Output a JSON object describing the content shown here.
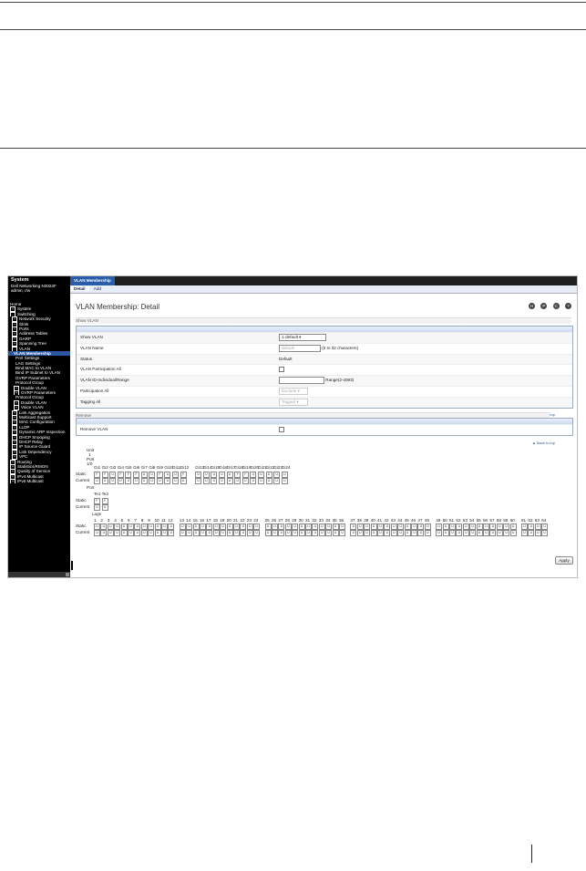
{
  "sidebar": {
    "title": "System",
    "device": "Dell Networking N3024F",
    "user": "admin, r/w",
    "items": [
      {
        "label": "Home",
        "pm": ""
      },
      {
        "label": "System",
        "pm": "+"
      },
      {
        "label": "Switching",
        "pm": "-"
      },
      {
        "label": "Network Security",
        "pm": "+"
      },
      {
        "label": "Slots",
        "pm": "+"
      },
      {
        "label": "Ports",
        "pm": "+"
      },
      {
        "label": "Address Tables",
        "pm": "+"
      },
      {
        "label": "GARP",
        "pm": "+"
      },
      {
        "label": "Spanning Tree",
        "pm": "+"
      },
      {
        "label": "VLAN",
        "pm": "-"
      },
      {
        "label": "VLAN Membership",
        "pm": ""
      },
      {
        "label": "Port Settings",
        "pm": ""
      },
      {
        "label": "LAG Settings",
        "pm": ""
      },
      {
        "label": "Bind MAC to VLAN",
        "pm": ""
      },
      {
        "label": "Bind IP Subnet to VLAN",
        "pm": ""
      },
      {
        "label": "GVRP Parameters",
        "pm": ""
      },
      {
        "label": "Protocol Group",
        "pm": ""
      },
      {
        "label": "Double VLAN",
        "pm": "+"
      },
      {
        "label": "GVRP Parameters",
        "pm": "+"
      },
      {
        "label": "Protocol Group",
        "pm": ""
      },
      {
        "label": "Double VLAN",
        "pm": "+"
      },
      {
        "label": "Voice VLAN",
        "pm": "+"
      },
      {
        "label": "Link Aggregation",
        "pm": "+"
      },
      {
        "label": "Multicast Support",
        "pm": "+"
      },
      {
        "label": "MAC Configuration",
        "pm": "+"
      },
      {
        "label": "LLDP",
        "pm": "+"
      },
      {
        "label": "Dynamic ARP Inspection",
        "pm": "+"
      },
      {
        "label": "DHCP Snooping",
        "pm": "+"
      },
      {
        "label": "DHCP Relay",
        "pm": "+"
      },
      {
        "label": "IP Source Guard",
        "pm": "+"
      },
      {
        "label": "Link Dependency",
        "pm": "+"
      },
      {
        "label": "VPC",
        "pm": "+"
      },
      {
        "label": "Routing",
        "pm": "+"
      },
      {
        "label": "Statistics/RMON",
        "pm": "+"
      },
      {
        "label": "Quality of Service",
        "pm": "+"
      },
      {
        "label": "IPv4 Multicast",
        "pm": "+"
      },
      {
        "label": "IPv6 Multicast",
        "pm": "+"
      }
    ]
  },
  "header": {
    "tab": "VLAN Membership",
    "subtabs": [
      "Detail",
      "Add"
    ],
    "page_title": "VLAN Membership: Detail",
    "icons": [
      "save-icon",
      "print-icon",
      "refresh-icon",
      "help-icon"
    ],
    "icon_glyphs": [
      "H",
      "P",
      "C",
      "?"
    ]
  },
  "show_vlan": {
    "section_label": "Show VLAN",
    "show_vlan_label": "Show VLAN",
    "show_vlan_value": "1-default",
    "vlan_name_label": "VLAN Name",
    "vlan_name_placeholder": "default",
    "vlan_name_hint": "(0 to 32 characters)",
    "status_label": "Status",
    "status_value": "Default",
    "participation_all_label": "VLAN Participation All",
    "range_label": "VLAN ID-Individual/Range",
    "range_hint": "Range(2-4093)",
    "participation_label": "Participation All",
    "participation_value": "Exclude",
    "tagged_label": "Tagging All",
    "tagged_value": "Tagged",
    "back_to_top": "Back to top"
  },
  "remove": {
    "section_label": "Remove",
    "remove_vlan_label": "Remove VLAN",
    "back_to_top": "Back to top"
  },
  "unit_grid": {
    "unit_label": "Unit",
    "unit_value": "1",
    "port_label": "Port",
    "port_value": "1/0",
    "ports": [
      "Gi1",
      "Gi2",
      "Gi3",
      "Gi4",
      "Gi5",
      "Gi6",
      "Gi7",
      "Gi8",
      "Gi9",
      "Gi10",
      "Gi11",
      "Gi12",
      "Gi13",
      "Gi14",
      "Gi15",
      "Gi16",
      "Gi17",
      "Gi18",
      "Gi19",
      "Gi20",
      "Gi21",
      "Gi22",
      "Gi23",
      "Gi24"
    ],
    "static": [
      "F",
      "F",
      "U",
      "F",
      "F",
      "F",
      "U",
      "U",
      "F",
      "U",
      "U",
      "F",
      "U",
      "U",
      "U",
      "U",
      "U",
      "F",
      "F",
      "U",
      "U",
      "U",
      "U",
      "U"
    ],
    "current": [
      "U",
      "U",
      "U",
      "U",
      "U",
      "U",
      "U",
      "U",
      "U",
      "U",
      "U",
      "U",
      "U",
      "U",
      "U",
      "U",
      "U",
      "U",
      "U",
      "U",
      "U",
      "U",
      "U",
      "U"
    ],
    "static_label": "Static",
    "current_label": "Current"
  },
  "te_grid": {
    "port_label": "Port",
    "ports": [
      "Te1",
      "Te2"
    ],
    "static": [
      "F",
      "F"
    ],
    "current": [
      "U",
      "U"
    ],
    "static_label": "Static",
    "current_label": "Current"
  },
  "lag_grid": {
    "lag_label": "Lags",
    "lags": [
      "1",
      "2",
      "3",
      "4",
      "5",
      "6",
      "7",
      "8",
      "9",
      "10",
      "11",
      "12",
      "13",
      "14",
      "15",
      "16",
      "17",
      "18",
      "19",
      "20",
      "21",
      "22",
      "23",
      "24",
      "25",
      "26",
      "27",
      "28",
      "29",
      "30",
      "31",
      "32",
      "33",
      "34",
      "35",
      "36",
      "37",
      "38",
      "39",
      "40",
      "41",
      "42",
      "43",
      "44",
      "45",
      "46",
      "47",
      "48",
      "49",
      "50",
      "51",
      "52",
      "53",
      "54",
      "55",
      "56",
      "57",
      "58",
      "59",
      "60",
      "61",
      "62",
      "63",
      "64"
    ],
    "static_label": "Static",
    "current_label": "Current",
    "cell_value": "U"
  },
  "apply_label": "Apply"
}
